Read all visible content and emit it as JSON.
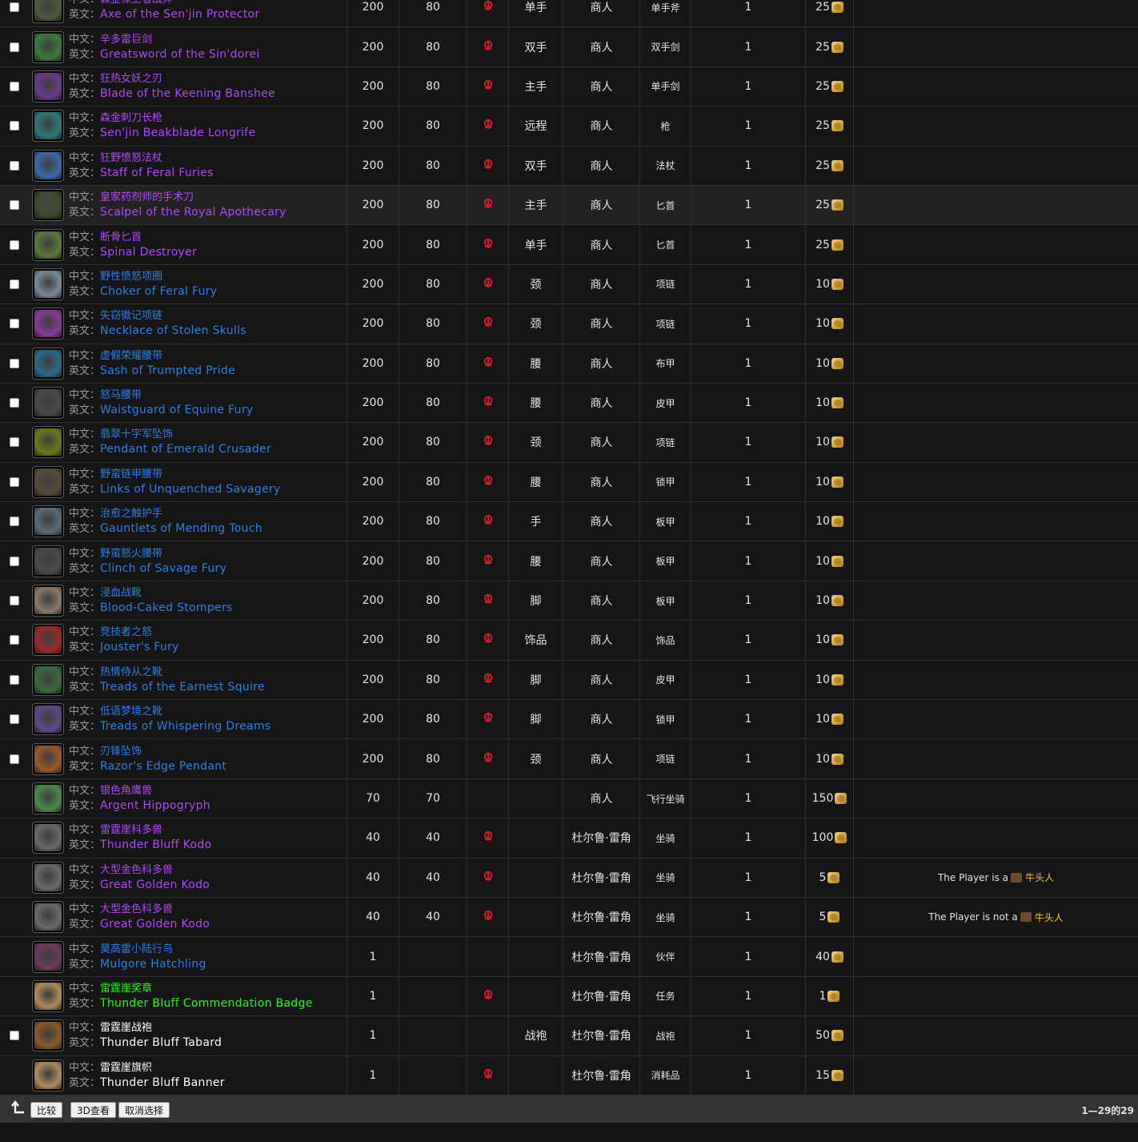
{
  "labels": {
    "zh": "中文：",
    "en": "英文："
  },
  "rows": [
    {
      "check": true,
      "zh": "森金保卫者战斧",
      "en": "Axe of the Sen'jin Protector",
      "q": "epic",
      "level": "200",
      "req": "80",
      "horde": true,
      "slot": "单手",
      "source": "商人",
      "type": "单手斧",
      "qty": "1",
      "cost": "25",
      "note": null,
      "hl": false,
      "icon": "#4a5a3a"
    },
    {
      "check": true,
      "zh": "辛多雷巨剑",
      "en": "Greatsword of the Sin'dorei",
      "q": "epic",
      "level": "200",
      "req": "80",
      "horde": true,
      "slot": "双手",
      "source": "商人",
      "type": "双手剑",
      "qty": "1",
      "cost": "25",
      "note": null,
      "hl": false,
      "icon": "#3a7a3a"
    },
    {
      "check": true,
      "zh": "狂热女妖之刃",
      "en": "Blade of the Keening Banshee",
      "q": "epic",
      "level": "200",
      "req": "80",
      "horde": true,
      "slot": "主手",
      "source": "商人",
      "type": "单手剑",
      "qty": "1",
      "cost": "25",
      "note": null,
      "hl": false,
      "icon": "#6a3a8a"
    },
    {
      "check": true,
      "zh": "森金刺刀长枪",
      "en": "Sen'jin Beakblade Longrife",
      "q": "epic",
      "level": "200",
      "req": "80",
      "horde": true,
      "slot": "远程",
      "source": "商人",
      "type": "枪",
      "qty": "1",
      "cost": "25",
      "note": null,
      "hl": false,
      "icon": "#2a7a7a"
    },
    {
      "check": true,
      "zh": "狂野愤怒法杖",
      "en": "Staff of Feral Furies",
      "q": "epic",
      "level": "200",
      "req": "80",
      "horde": true,
      "slot": "双手",
      "source": "商人",
      "type": "法杖",
      "qty": "1",
      "cost": "25",
      "note": null,
      "hl": false,
      "icon": "#3a6aaa"
    },
    {
      "check": true,
      "zh": "皇家药剂师的手术刀",
      "en": "Scalpel of the Royal Apothecary",
      "q": "epic",
      "level": "200",
      "req": "80",
      "horde": true,
      "slot": "主手",
      "source": "商人",
      "type": "匕首",
      "qty": "1",
      "cost": "25",
      "note": null,
      "hl": true,
      "icon": "#3a4a2a"
    },
    {
      "check": true,
      "zh": "断骨匕首",
      "en": "Spinal Destroyer",
      "q": "epic",
      "level": "200",
      "req": "80",
      "horde": true,
      "slot": "单手",
      "source": "商人",
      "type": "匕首",
      "qty": "1",
      "cost": "25",
      "note": null,
      "hl": false,
      "icon": "#5a7a3a"
    },
    {
      "check": true,
      "zh": "野性愤怒项圈",
      "en": "Choker of Feral Fury",
      "q": "rare",
      "level": "200",
      "req": "80",
      "horde": true,
      "slot": "颈",
      "source": "商人",
      "type": "项链",
      "qty": "1",
      "cost": "10",
      "note": null,
      "hl": false,
      "icon": "#7a8a9a"
    },
    {
      "check": true,
      "zh": "失窃徽记项链",
      "en": "Necklace of Stolen Skulls",
      "q": "rare",
      "level": "200",
      "req": "80",
      "horde": true,
      "slot": "颈",
      "source": "商人",
      "type": "项链",
      "qty": "1",
      "cost": "10",
      "note": null,
      "hl": false,
      "icon": "#8a3a9a"
    },
    {
      "check": true,
      "zh": "虚假荣耀腰带",
      "en": "Sash of Trumpted Pride",
      "q": "rare",
      "level": "200",
      "req": "80",
      "horde": true,
      "slot": "腰",
      "source": "商人",
      "type": "布甲",
      "qty": "1",
      "cost": "10",
      "note": null,
      "hl": false,
      "icon": "#2a6a8a"
    },
    {
      "check": true,
      "zh": "怒马腰带",
      "en": "Waistguard of Equine Fury",
      "q": "rare",
      "level": "200",
      "req": "80",
      "horde": true,
      "slot": "腰",
      "source": "商人",
      "type": "皮甲",
      "qty": "1",
      "cost": "10",
      "note": null,
      "hl": false,
      "icon": "#4a4a4a"
    },
    {
      "check": true,
      "zh": "翡翠十字军坠饰",
      "en": "Pendant of Emerald Crusader",
      "q": "rare",
      "level": "200",
      "req": "80",
      "horde": true,
      "slot": "颈",
      "source": "商人",
      "type": "项链",
      "qty": "1",
      "cost": "10",
      "note": null,
      "hl": false,
      "icon": "#6a7a1a"
    },
    {
      "check": true,
      "zh": "野蛮链甲腰带",
      "en": "Links of Unquenched Savagery",
      "q": "rare",
      "level": "200",
      "req": "80",
      "horde": true,
      "slot": "腰",
      "source": "商人",
      "type": "锁甲",
      "qty": "1",
      "cost": "10",
      "note": null,
      "hl": false,
      "icon": "#5a4a3a"
    },
    {
      "check": true,
      "zh": "治愈之触护手",
      "en": "Gauntlets of Mending Touch",
      "q": "rare",
      "level": "200",
      "req": "80",
      "horde": true,
      "slot": "手",
      "source": "商人",
      "type": "板甲",
      "qty": "1",
      "cost": "10",
      "note": null,
      "hl": false,
      "icon": "#5a6a7a"
    },
    {
      "check": true,
      "zh": "野蛮怒火腰带",
      "en": "Clinch of Savage Fury",
      "q": "rare",
      "level": "200",
      "req": "80",
      "horde": true,
      "slot": "腰",
      "source": "商人",
      "type": "板甲",
      "qty": "1",
      "cost": "10",
      "note": null,
      "hl": false,
      "icon": "#4a4a4a"
    },
    {
      "check": true,
      "zh": "浸血战靴",
      "en": "Blood-Caked Stompers",
      "q": "rare",
      "level": "200",
      "req": "80",
      "horde": true,
      "slot": "脚",
      "source": "商人",
      "type": "板甲",
      "qty": "1",
      "cost": "10",
      "note": null,
      "hl": false,
      "icon": "#8a7a6a"
    },
    {
      "check": true,
      "zh": "竞技者之怒",
      "en": "Jouster's Fury",
      "q": "rare",
      "level": "200",
      "req": "80",
      "horde": true,
      "slot": "饰品",
      "source": "商人",
      "type": "饰品",
      "qty": "1",
      "cost": "10",
      "note": null,
      "hl": false,
      "icon": "#9a2a2a"
    },
    {
      "check": true,
      "zh": "热情侍从之靴",
      "en": "Treads of the Earnest Squire",
      "q": "rare",
      "level": "200",
      "req": "80",
      "horde": true,
      "slot": "脚",
      "source": "商人",
      "type": "皮甲",
      "qty": "1",
      "cost": "10",
      "note": null,
      "hl": false,
      "icon": "#3a6a3a"
    },
    {
      "check": true,
      "zh": "低语梦境之靴",
      "en": "Treads of Whispering Dreams",
      "q": "rare",
      "level": "200",
      "req": "80",
      "horde": true,
      "slot": "脚",
      "source": "商人",
      "type": "锁甲",
      "qty": "1",
      "cost": "10",
      "note": null,
      "hl": false,
      "icon": "#5a4a8a"
    },
    {
      "check": true,
      "zh": "刃锋坠饰",
      "en": "Razor's Edge Pendant",
      "q": "rare",
      "level": "200",
      "req": "80",
      "horde": true,
      "slot": "颈",
      "source": "商人",
      "type": "项链",
      "qty": "1",
      "cost": "10",
      "note": null,
      "hl": false,
      "icon": "#9a5a2a"
    },
    {
      "check": false,
      "zh": "银色角鹰兽",
      "en": "Argent Hippogryph",
      "q": "epic",
      "level": "70",
      "req": "70",
      "horde": false,
      "slot": "",
      "source": "商人",
      "type": "飞行坐骑",
      "qty": "1",
      "cost": "150",
      "note": null,
      "hl": false,
      "icon": "#4a8a4a"
    },
    {
      "check": false,
      "zh": "雷霆崖科多兽",
      "en": "Thunder Bluff Kodo",
      "q": "epic",
      "level": "40",
      "req": "40",
      "horde": true,
      "slot": "",
      "source": "杜尔鲁·雷角",
      "type": "坐骑",
      "qty": "1",
      "cost": "100",
      "note": null,
      "hl": false,
      "icon": "#6a6a6a"
    },
    {
      "check": false,
      "zh": "大型金色科多兽",
      "en": "Great Golden Kodo",
      "q": "epic",
      "level": "40",
      "req": "40",
      "horde": true,
      "slot": "",
      "source": "杜尔鲁·雷角",
      "type": "坐骑",
      "qty": "1",
      "cost": "5",
      "note": {
        "text": "The Player is a",
        "race": "牛头人"
      },
      "hl": false,
      "icon": "#6a6a6a"
    },
    {
      "check": false,
      "zh": "大型金色科多兽",
      "en": "Great Golden Kodo",
      "q": "epic",
      "level": "40",
      "req": "40",
      "horde": true,
      "slot": "",
      "source": "杜尔鲁·雷角",
      "type": "坐骑",
      "qty": "1",
      "cost": "5",
      "note": {
        "text": "The Player is not a",
        "race": "牛头人"
      },
      "hl": false,
      "icon": "#6a6a6a"
    },
    {
      "check": false,
      "zh": "莫高雷小陆行鸟",
      "en": "Mulgore Hatchling",
      "q": "rare",
      "level": "1",
      "req": "",
      "horde": false,
      "slot": "",
      "source": "杜尔鲁·雷角",
      "type": "伙伴",
      "qty": "1",
      "cost": "40",
      "note": null,
      "hl": false,
      "icon": "#6a3a5a"
    },
    {
      "check": false,
      "zh": "雷霆崖奖章",
      "en": "Thunder Bluff Commendation Badge",
      "q": "unc",
      "level": "1",
      "req": "",
      "horde": true,
      "slot": "",
      "source": "杜尔鲁·雷角",
      "type": "任务",
      "qty": "1",
      "cost": "1",
      "note": null,
      "hl": false,
      "icon": "#b08a5a"
    },
    {
      "check": true,
      "zh": "雷霆崖战袍",
      "en": "Thunder Bluff Tabard",
      "q": "com",
      "level": "1",
      "req": "",
      "horde": false,
      "slot": "战袍",
      "source": "杜尔鲁·雷角",
      "type": "战袍",
      "qty": "1",
      "cost": "50",
      "note": null,
      "hl": false,
      "icon": "#8a5a2a"
    },
    {
      "check": false,
      "zh": "雷霆崖旗帜",
      "en": "Thunder Bluff Banner",
      "q": "com",
      "level": "1",
      "req": "",
      "horde": true,
      "slot": "",
      "source": "杜尔鲁·雷角",
      "type": "消耗品",
      "qty": "1",
      "cost": "15",
      "note": null,
      "hl": false,
      "icon": "#b08a5a"
    }
  ],
  "footer": {
    "compare": "比较",
    "view3d": "3D查看",
    "deselect": "取消选择",
    "pager": "1—29的29"
  },
  "colors": {
    "epic": "#b048f8",
    "rare": "#2e7fe6",
    "uncommon": "#1eff00",
    "common": "#ffffff",
    "horde": "#d8182a",
    "race": "#f5c518"
  }
}
